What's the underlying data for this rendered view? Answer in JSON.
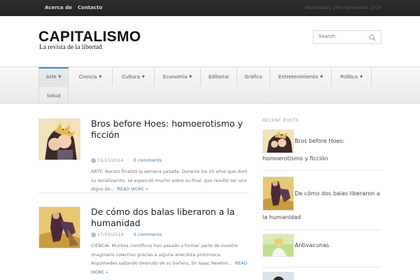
{
  "topbar": {
    "links": [
      "Acerca de",
      "Contacto"
    ],
    "date": "Wednesday 26th November 2014"
  },
  "header": {
    "logo": "CAPITALISMO",
    "tagline": "La revista de la libertad",
    "search_placeholder": "Search"
  },
  "nav": {
    "items": [
      {
        "label": "Arte",
        "dropdown": true
      },
      {
        "label": "Ciencia",
        "dropdown": true
      },
      {
        "label": "Cultura",
        "dropdown": true
      },
      {
        "label": "Economía",
        "dropdown": true
      },
      {
        "label": "Editorial",
        "dropdown": false
      },
      {
        "label": "Gráfico",
        "dropdown": false
      },
      {
        "label": "Entretenimiento",
        "dropdown": true
      },
      {
        "label": "Política",
        "dropdown": true
      },
      {
        "label": "Salud",
        "dropdown": false
      }
    ],
    "caret": "▼"
  },
  "posts": [
    {
      "title": "Bros before Hoes: homoerotismo y ficción",
      "date": "11/11/2014",
      "comments": "0 comments",
      "excerpt": "ARTE:  Naruto finalizó la semana pasada. Durante los 15 años que duró su serialización, se especuló mucho sobre su final, que resultó ser uno digno de...",
      "more": "READ MORE »"
    },
    {
      "title": "De cómo dos balas liberaron a la humanidad",
      "date": "17/10/2014",
      "comments": "0 comments",
      "excerpt": "CIENCIA:  Muchos científicos han pasado a formar parte de nuestro imaginario colectivo gracias a alguna anécdota pintoresca: Arquímedes saltando desnudo de su bañera, Sir Isaac Newton...",
      "more": "READ MORE »"
    }
  ],
  "sidebar": {
    "title": "RECENT POSTS",
    "items": [
      {
        "line1": "Bros before Hoes:",
        "line2": "homoerotismo y ficción"
      },
      {
        "line1": "De cómo dos balas liberaron a",
        "line2": "la humanidad"
      },
      {
        "line1": "Antivacunas",
        "line2": ""
      }
    ]
  },
  "colors": {
    "accent": "#3a8fd6",
    "link": "#3a7fc0",
    "topbar": "#2a2a2a"
  }
}
